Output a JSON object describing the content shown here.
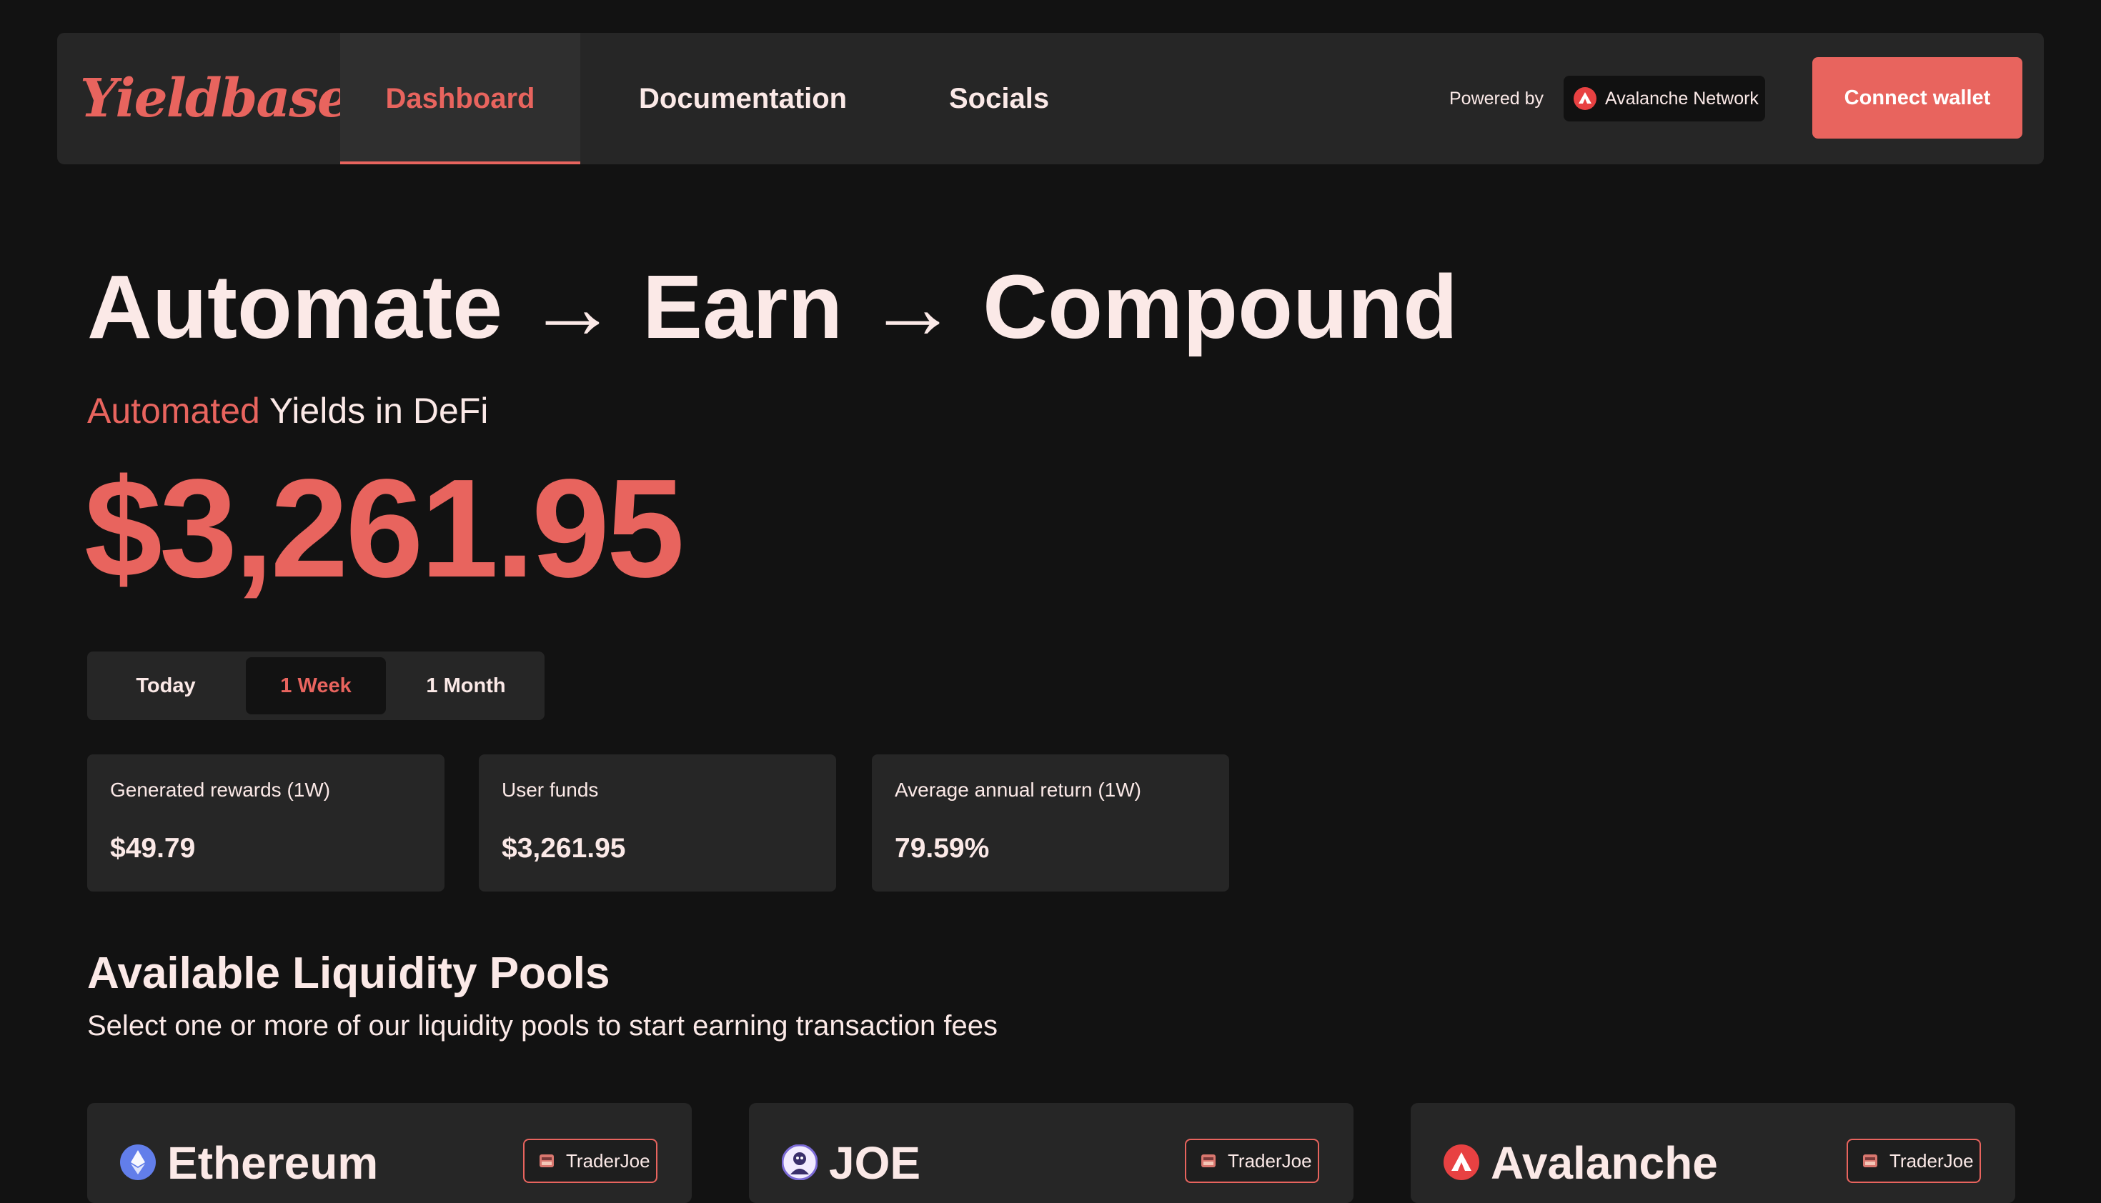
{
  "nav": {
    "logo": "Yieldbase.",
    "tabs": [
      {
        "label": "Dashboard",
        "active": true
      },
      {
        "label": "Documentation",
        "active": false
      },
      {
        "label": "Socials",
        "active": false
      }
    ],
    "powered_by": "Powered by",
    "network": "Avalanche Network",
    "network_icon": "avalanche-icon",
    "connect_label": "Connect wallet"
  },
  "hero": {
    "title": "Automate → Earn → Compound",
    "subtitle_accent": "Automated",
    "subtitle_rest": " Yields in DeFi",
    "amount": "$3,261.95"
  },
  "periods": {
    "options": [
      "Today",
      "1 Week",
      "1 Month"
    ],
    "selected": "1 Week"
  },
  "stats": [
    {
      "label": "Generated rewards (1W)",
      "value": "$49.79"
    },
    {
      "label": "User funds",
      "value": "$3,261.95"
    },
    {
      "label": "Average annual return (1W)",
      "value": "79.59%"
    }
  ],
  "pools": {
    "heading": "Available Liquidity Pools",
    "subheading": "Select one or more of our liquidity pools to start earning transaction fees",
    "items": [
      {
        "name": "Ethereum",
        "icon": "ethereum-icon",
        "dex": "TraderJoe"
      },
      {
        "name": "JOE",
        "icon": "joe-icon",
        "dex": "TraderJoe"
      },
      {
        "name": "Avalanche",
        "icon": "avalanche-icon",
        "dex": "TraderJoe"
      }
    ]
  },
  "colors": {
    "accent": "#e8645e",
    "background": "#121212",
    "card": "#262626",
    "text": "#fbe9e7",
    "ethereum": "#627eea",
    "avalanche": "#e84142"
  }
}
